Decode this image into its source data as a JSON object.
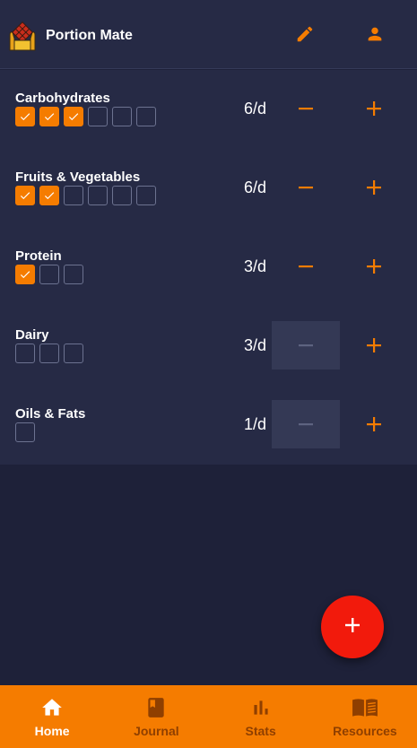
{
  "header": {
    "app_title": "Portion Mate",
    "edit_icon": "pencil-icon",
    "profile_icon": "person-icon"
  },
  "categories": [
    {
      "label": "Carbohydrates",
      "rate": "6/d",
      "total": 6,
      "checked": 3,
      "decrement_enabled": true
    },
    {
      "label": "Fruits & Vegetables",
      "rate": "6/d",
      "total": 6,
      "checked": 2,
      "decrement_enabled": true
    },
    {
      "label": "Protein",
      "rate": "3/d",
      "total": 3,
      "checked": 1,
      "decrement_enabled": true
    },
    {
      "label": "Dairy",
      "rate": "3/d",
      "total": 3,
      "checked": 0,
      "decrement_enabled": false
    },
    {
      "label": "Oils & Fats",
      "rate": "1/d",
      "total": 1,
      "checked": 0,
      "decrement_enabled": false
    }
  ],
  "fab": {
    "icon": "plus-icon"
  },
  "bottom_nav": [
    {
      "label": "Home",
      "icon": "home-icon",
      "active": true
    },
    {
      "label": "Journal",
      "icon": "book-icon",
      "active": false
    },
    {
      "label": "Stats",
      "icon": "bar-chart-icon",
      "active": false
    },
    {
      "label": "Resources",
      "icon": "open-book-icon",
      "active": false
    }
  ],
  "colors": {
    "accent": "#f57c00",
    "background": "#1e2139",
    "panel": "#262a45",
    "fab": "#f21a0c",
    "disabled_button": "#343955",
    "nav_inactive_text": "#8f3f00"
  }
}
